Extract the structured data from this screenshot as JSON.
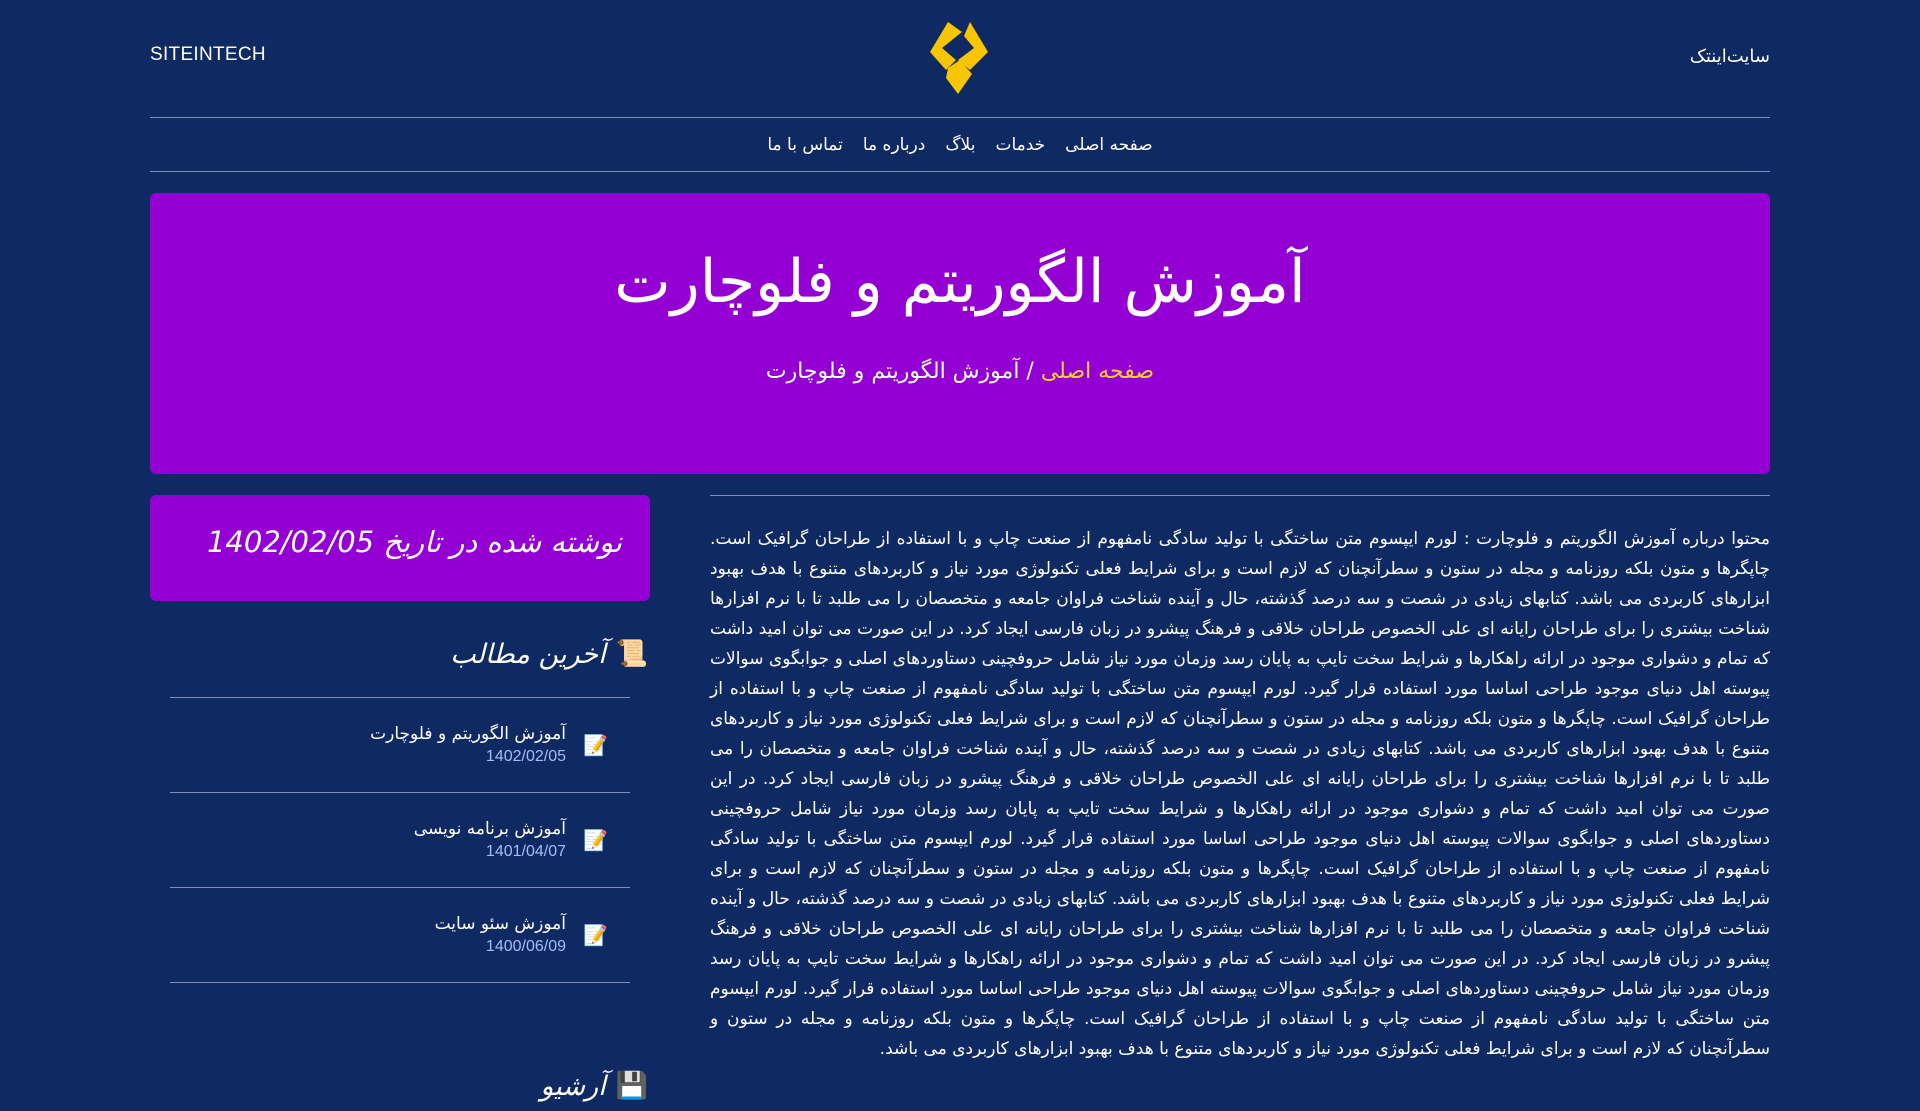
{
  "header": {
    "brand_en": "SITEINTECH",
    "brand_fa": "سایت‌اینتک"
  },
  "nav": {
    "items": [
      "صفحه اصلی",
      "خدمات",
      "بلاگ",
      "درباره ما",
      "تماس با ما"
    ]
  },
  "hero": {
    "title": "آموزش الگوریتم و فلوچارت",
    "breadcrumb_home": "صفحه اصلی",
    "breadcrumb_sep": " / ",
    "breadcrumb_current": "آموزش الگوریتم و فلوچارت"
  },
  "sidebar": {
    "date_label": "نوشته شده در تاریخ 1402/02/05",
    "recent_heading": "آخرین مطالب",
    "recent_posts": [
      {
        "title": "آموزش الگوریتم و فلوچارت",
        "date": "1402/02/05"
      },
      {
        "title": "آموزش برنامه نویسی",
        "date": "1401/04/07"
      },
      {
        "title": "آموزش سئو سایت",
        "date": "1400/06/09"
      }
    ],
    "archive_heading": "آرشیو"
  },
  "content": {
    "body": "محتوا درباره آموزش الگوریتم و فلوچارت : لورم ایپسوم متن ساختگی با تولید سادگی نامفهوم از صنعت چاپ و با استفاده از طراحان گرافیک است. چاپگرها و متون بلکه روزنامه و مجله در ستون و سطرآنچنان که لازم است و برای شرایط فعلی تکنولوژی مورد نیاز و کاربردهای متنوع با هدف بهبود ابزارهای کاربردی می باشد. کتابهای زیادی در شصت و سه درصد گذشته، حال و آینده شناخت فراوان جامعه و متخصصان را می طلبد تا با نرم افزارها شناخت بیشتری را برای طراحان رایانه ای علی الخصوص طراحان خلاقی و فرهنگ پیشرو در زبان فارسی ایجاد کرد. در این صورت می توان امید داشت که تمام و دشواری موجود در ارائه راهکارها و شرایط سخت تایپ به پایان رسد وزمان مورد نیاز شامل حروفچینی دستاوردهای اصلی و جوابگوی سوالات پیوسته اهل دنیای موجود طراحی اساسا مورد استفاده قرار گیرد. لورم ایپسوم متن ساختگی با تولید سادگی نامفهوم از صنعت چاپ و با استفاده از طراحان گرافیک است. چاپگرها و متون بلکه روزنامه و مجله در ستون و سطرآنچنان که لازم است و برای شرایط فعلی تکنولوژی مورد نیاز و کاربردهای متنوع با هدف بهبود ابزارهای کاربردی می باشد. کتابهای زیادی در شصت و سه درصد گذشته، حال و آینده شناخت فراوان جامعه و متخصصان را می طلبد تا با نرم افزارها شناخت بیشتری را برای طراحان رایانه ای علی الخصوص طراحان خلاقی و فرهنگ پیشرو در زبان فارسی ایجاد کرد. در این صورت می توان امید داشت که تمام و دشواری موجود در ارائه راهکارها و شرایط سخت تایپ به پایان رسد وزمان مورد نیاز شامل حروفچینی دستاوردهای اصلی و جوابگوی سوالات پیوسته اهل دنیای موجود طراحی اساسا مورد استفاده قرار گیرد. لورم ایپسوم متن ساختگی با تولید سادگی نامفهوم از صنعت چاپ و با استفاده از طراحان گرافیک است. چاپگرها و متون بلکه روزنامه و مجله در ستون و سطرآنچنان که لازم است و برای شرایط فعلی تکنولوژی مورد نیاز و کاربردهای متنوع با هدف بهبود ابزارهای کاربردی می باشد. کتابهای زیادی در شصت و سه درصد گذشته، حال و آینده شناخت فراوان جامعه و متخصصان را می طلبد تا با نرم افزارها شناخت بیشتری را برای طراحان رایانه ای علی الخصوص طراحان خلاقی و فرهنگ پیشرو در زبان فارسی ایجاد کرد. در این صورت می توان امید داشت که تمام و دشواری موجود در ارائه راهکارها و شرایط سخت تایپ به پایان رسد وزمان مورد نیاز شامل حروفچینی دستاوردهای اصلی و جوابگوی سوالات پیوسته اهل دنیای موجود طراحی اساسا مورد استفاده قرار گیرد. لورم ایپسوم متن ساختگی با تولید سادگی نامفهوم از صنعت چاپ و با استفاده از طراحان گرافیک است. چاپگرها و متون بلکه روزنامه و مجله در ستون و سطرآنچنان که لازم است و برای شرایط فعلی تکنولوژی مورد نیاز و کاربردهای متنوع با هدف بهبود ابزارهای کاربردی می باشد."
  },
  "colors": {
    "page_bg": "#0f2a63",
    "accent": "#9400d3",
    "breadcrumb_home": "#ffcc33",
    "post_date": "#a9b8ff",
    "logo": "#f7c600"
  }
}
